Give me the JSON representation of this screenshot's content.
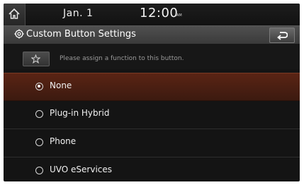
{
  "status": {
    "date": "Jan.  1",
    "time": "12:00",
    "ampm": "AM"
  },
  "header": {
    "title": "Custom Button Settings"
  },
  "hint": "Please assign a function to this button.",
  "options": [
    {
      "label": "None",
      "selected": true
    },
    {
      "label": "Plug-in Hybrid",
      "selected": false
    },
    {
      "label": "Phone",
      "selected": false
    },
    {
      "label": "UVO eServices",
      "selected": false
    }
  ],
  "colors": {
    "selected_row": "#5a2414",
    "background": "#141414"
  },
  "icons": {
    "home": "home-icon",
    "settings": "gear-icon",
    "back": "back-arrow-icon",
    "favorite": "star-icon"
  }
}
